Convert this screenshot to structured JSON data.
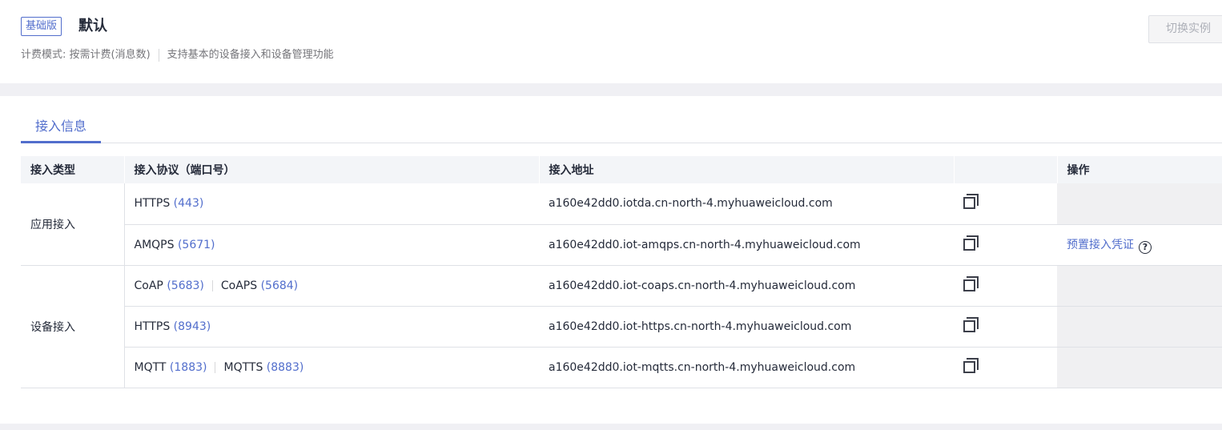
{
  "header": {
    "edition_badge": "基础版",
    "instance_name": "默认",
    "billing": "计费模式: 按需计费(消息数)",
    "description": "支持基本的设备接入和设备管理功能",
    "switch_button": "切换实例"
  },
  "tabs": [
    {
      "label": "接入信息",
      "active": true
    }
  ],
  "table": {
    "columns": [
      "接入类型",
      "接入协议（端口号）",
      "接入地址",
      "",
      "操作"
    ],
    "groups": [
      {
        "type": "应用接入",
        "rows": [
          {
            "protocols": [
              {
                "name": "HTTPS",
                "port": "(443)"
              }
            ],
            "address": "a160e42dd0.iotda.cn-north-4.myhuaweicloud.com",
            "operation": ""
          },
          {
            "protocols": [
              {
                "name": "AMQPS",
                "port": "(5671)"
              }
            ],
            "address": "a160e42dd0.iot-amqps.cn-north-4.myhuaweicloud.com",
            "operation": "预置接入凭证"
          }
        ]
      },
      {
        "type": "设备接入",
        "rows": [
          {
            "protocols": [
              {
                "name": "CoAP",
                "port": "(5683)"
              },
              {
                "name": "CoAPS",
                "port": "(5684)"
              }
            ],
            "address": "a160e42dd0.iot-coaps.cn-north-4.myhuaweicloud.com",
            "operation": ""
          },
          {
            "protocols": [
              {
                "name": "HTTPS",
                "port": "(8943)"
              }
            ],
            "address": "a160e42dd0.iot-https.cn-north-4.myhuaweicloud.com",
            "operation": ""
          },
          {
            "protocols": [
              {
                "name": "MQTT",
                "port": "(1883)"
              },
              {
                "name": "MQTTS",
                "port": "(8883)"
              }
            ],
            "address": "a160e42dd0.iot-mqtts.cn-north-4.myhuaweicloud.com",
            "operation": ""
          }
        ]
      }
    ]
  },
  "icons": {
    "copy": "copy-icon",
    "help": "question-circle-icon"
  },
  "help_glyph": "?",
  "colors": {
    "accent": "#526ecc",
    "text": "#252b3a",
    "muted": "#75757a"
  }
}
